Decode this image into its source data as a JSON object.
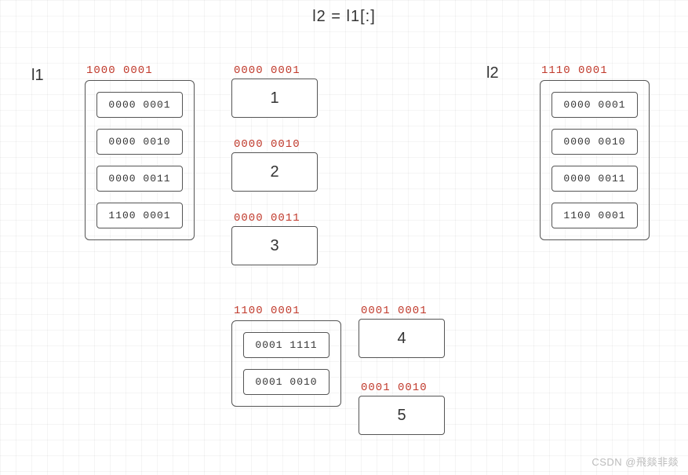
{
  "title": "l2 = l1[:]",
  "labels": {
    "l1": "l1",
    "l2": "l2"
  },
  "l1_list": {
    "address": "1000 0001",
    "cells": [
      "0000 0001",
      "0000 0010",
      "0000 0011",
      "1100 0001"
    ]
  },
  "l2_list": {
    "address": "1110 0001",
    "cells": [
      "0000 0001",
      "0000 0010",
      "0000 0011",
      "1100 0001"
    ]
  },
  "ints": [
    {
      "addr": "0000 0001",
      "val": "1"
    },
    {
      "addr": "0000 0010",
      "val": "2"
    },
    {
      "addr": "0000 0011",
      "val": "3"
    }
  ],
  "nested_list": {
    "address": "1100 0001",
    "cells": [
      "0001 1111",
      "0001 0010"
    ]
  },
  "nested_ints": [
    {
      "addr": "0001 0001",
      "val": "4"
    },
    {
      "addr": "0001 0010",
      "val": "5"
    }
  ],
  "watermark": "CSDN @飛燚非燚"
}
